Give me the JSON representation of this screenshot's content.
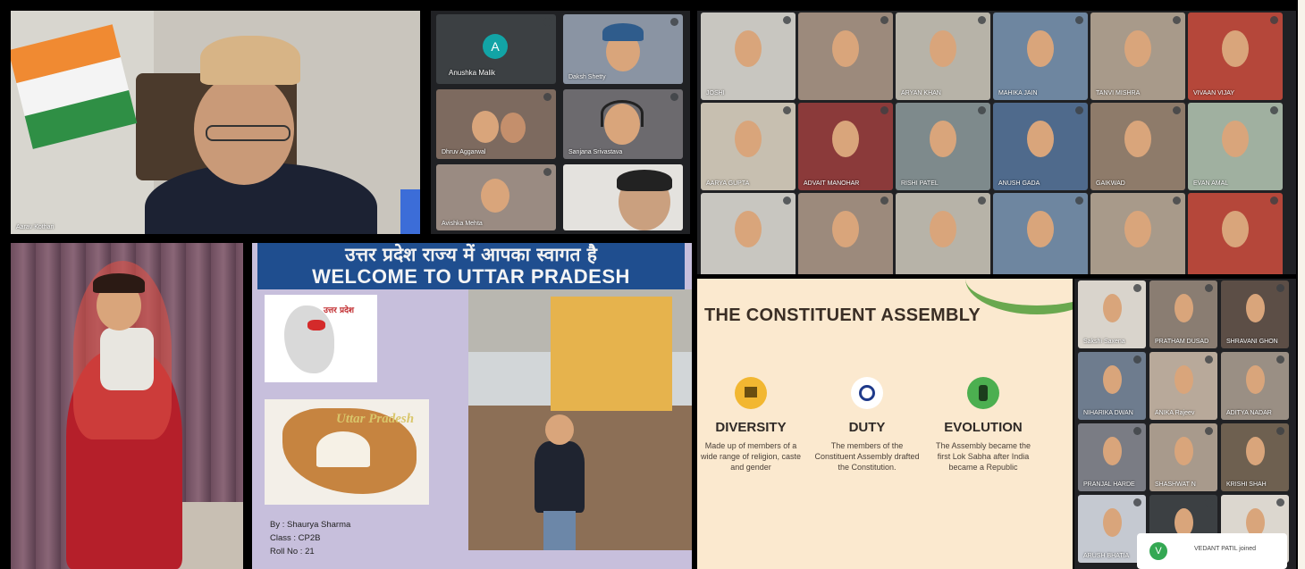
{
  "top_left": {
    "speaker_name": "Aarav Kothari"
  },
  "top_middle": {
    "avatar_letter": "A",
    "tiles": [
      "Anushka Malik",
      "Daksh Shetty",
      "Dhruv Aggarwal",
      "Sanjana Srivastava",
      "Avishka Mehta",
      ""
    ]
  },
  "top_right": {
    "tiles": [
      "JOSHI",
      "",
      "ARYAN KHAN",
      "MAHIKA JAIN",
      "TANVI MISHRA",
      "VIVAAN VIJAY",
      "AARYA GUPTA",
      "ADVAIT MANOHAR",
      "RISHI PATEL",
      "ANUSH GADA",
      "GAIKWAD",
      "EVAN AMAL",
      "",
      "",
      "",
      "",
      "",
      ""
    ]
  },
  "slide": {
    "banner_hindi": "उत्तर प्रदेश राज्य में आपका स्वागत है",
    "banner_english": "WELCOME TO UTTAR PRADESH",
    "map_label": "उत्तर प्रदेश",
    "art_label": "Uttar Pradesh",
    "by_line": "By : Shaurya Sharma",
    "class_line": "Class : CP2B",
    "roll_line": "Roll No : 21"
  },
  "constituent": {
    "title": "THE CONSTITUENT ASSEMBLY",
    "columns": [
      {
        "heading": "DIVERSITY",
        "body": "Made up of members of a wide range of religion, caste and gender",
        "icon": "flag-icon",
        "color": "#f2b731"
      },
      {
        "heading": "DUTY",
        "body": "The members of the Constituent Assembly drafted the Constitution.",
        "icon": "chakra-icon",
        "color": "#ffffff"
      },
      {
        "heading": "EVOLUTION",
        "body": "The Assembly became the first Lok Sabha after India became a Republic",
        "icon": "emblem-icon",
        "color": "#4caf50"
      }
    ]
  },
  "right_grid": {
    "tiles": [
      "Sakshi Saxena",
      "PRATHAM DUSAD",
      "SHRAVANI GHON",
      "NIHARIKA DWAN",
      "ANIKA Rajeev",
      "ADITYA NADAR",
      "PRANJAL HARDE",
      "SHASHWAT N",
      "KRISHI SHAH",
      "ARUSH BHATIA",
      "",
      ""
    ],
    "toast_avatar": "V",
    "toast_message": "VEDANT PATIL joined"
  }
}
